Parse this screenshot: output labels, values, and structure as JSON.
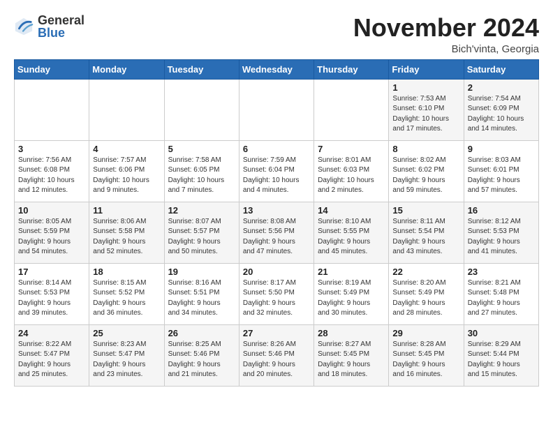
{
  "logo": {
    "general": "General",
    "blue": "Blue"
  },
  "header": {
    "month": "November 2024",
    "location": "Bich'vinta, Georgia"
  },
  "weekdays": [
    "Sunday",
    "Monday",
    "Tuesday",
    "Wednesday",
    "Thursday",
    "Friday",
    "Saturday"
  ],
  "weeks": [
    [
      {
        "day": "",
        "info": ""
      },
      {
        "day": "",
        "info": ""
      },
      {
        "day": "",
        "info": ""
      },
      {
        "day": "",
        "info": ""
      },
      {
        "day": "",
        "info": ""
      },
      {
        "day": "1",
        "info": "Sunrise: 7:53 AM\nSunset: 6:10 PM\nDaylight: 10 hours\nand 17 minutes."
      },
      {
        "day": "2",
        "info": "Sunrise: 7:54 AM\nSunset: 6:09 PM\nDaylight: 10 hours\nand 14 minutes."
      }
    ],
    [
      {
        "day": "3",
        "info": "Sunrise: 7:56 AM\nSunset: 6:08 PM\nDaylight: 10 hours\nand 12 minutes."
      },
      {
        "day": "4",
        "info": "Sunrise: 7:57 AM\nSunset: 6:06 PM\nDaylight: 10 hours\nand 9 minutes."
      },
      {
        "day": "5",
        "info": "Sunrise: 7:58 AM\nSunset: 6:05 PM\nDaylight: 10 hours\nand 7 minutes."
      },
      {
        "day": "6",
        "info": "Sunrise: 7:59 AM\nSunset: 6:04 PM\nDaylight: 10 hours\nand 4 minutes."
      },
      {
        "day": "7",
        "info": "Sunrise: 8:01 AM\nSunset: 6:03 PM\nDaylight: 10 hours\nand 2 minutes."
      },
      {
        "day": "8",
        "info": "Sunrise: 8:02 AM\nSunset: 6:02 PM\nDaylight: 9 hours\nand 59 minutes."
      },
      {
        "day": "9",
        "info": "Sunrise: 8:03 AM\nSunset: 6:01 PM\nDaylight: 9 hours\nand 57 minutes."
      }
    ],
    [
      {
        "day": "10",
        "info": "Sunrise: 8:05 AM\nSunset: 5:59 PM\nDaylight: 9 hours\nand 54 minutes."
      },
      {
        "day": "11",
        "info": "Sunrise: 8:06 AM\nSunset: 5:58 PM\nDaylight: 9 hours\nand 52 minutes."
      },
      {
        "day": "12",
        "info": "Sunrise: 8:07 AM\nSunset: 5:57 PM\nDaylight: 9 hours\nand 50 minutes."
      },
      {
        "day": "13",
        "info": "Sunrise: 8:08 AM\nSunset: 5:56 PM\nDaylight: 9 hours\nand 47 minutes."
      },
      {
        "day": "14",
        "info": "Sunrise: 8:10 AM\nSunset: 5:55 PM\nDaylight: 9 hours\nand 45 minutes."
      },
      {
        "day": "15",
        "info": "Sunrise: 8:11 AM\nSunset: 5:54 PM\nDaylight: 9 hours\nand 43 minutes."
      },
      {
        "day": "16",
        "info": "Sunrise: 8:12 AM\nSunset: 5:53 PM\nDaylight: 9 hours\nand 41 minutes."
      }
    ],
    [
      {
        "day": "17",
        "info": "Sunrise: 8:14 AM\nSunset: 5:53 PM\nDaylight: 9 hours\nand 39 minutes."
      },
      {
        "day": "18",
        "info": "Sunrise: 8:15 AM\nSunset: 5:52 PM\nDaylight: 9 hours\nand 36 minutes."
      },
      {
        "day": "19",
        "info": "Sunrise: 8:16 AM\nSunset: 5:51 PM\nDaylight: 9 hours\nand 34 minutes."
      },
      {
        "day": "20",
        "info": "Sunrise: 8:17 AM\nSunset: 5:50 PM\nDaylight: 9 hours\nand 32 minutes."
      },
      {
        "day": "21",
        "info": "Sunrise: 8:19 AM\nSunset: 5:49 PM\nDaylight: 9 hours\nand 30 minutes."
      },
      {
        "day": "22",
        "info": "Sunrise: 8:20 AM\nSunset: 5:49 PM\nDaylight: 9 hours\nand 28 minutes."
      },
      {
        "day": "23",
        "info": "Sunrise: 8:21 AM\nSunset: 5:48 PM\nDaylight: 9 hours\nand 27 minutes."
      }
    ],
    [
      {
        "day": "24",
        "info": "Sunrise: 8:22 AM\nSunset: 5:47 PM\nDaylight: 9 hours\nand 25 minutes."
      },
      {
        "day": "25",
        "info": "Sunrise: 8:23 AM\nSunset: 5:47 PM\nDaylight: 9 hours\nand 23 minutes."
      },
      {
        "day": "26",
        "info": "Sunrise: 8:25 AM\nSunset: 5:46 PM\nDaylight: 9 hours\nand 21 minutes."
      },
      {
        "day": "27",
        "info": "Sunrise: 8:26 AM\nSunset: 5:46 PM\nDaylight: 9 hours\nand 20 minutes."
      },
      {
        "day": "28",
        "info": "Sunrise: 8:27 AM\nSunset: 5:45 PM\nDaylight: 9 hours\nand 18 minutes."
      },
      {
        "day": "29",
        "info": "Sunrise: 8:28 AM\nSunset: 5:45 PM\nDaylight: 9 hours\nand 16 minutes."
      },
      {
        "day": "30",
        "info": "Sunrise: 8:29 AM\nSunset: 5:44 PM\nDaylight: 9 hours\nand 15 minutes."
      }
    ]
  ]
}
